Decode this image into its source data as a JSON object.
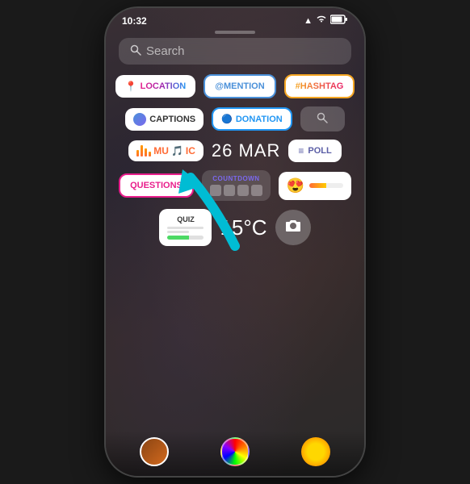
{
  "phone": {
    "status_bar": {
      "time": "10:32",
      "signal_icon": "▲",
      "wifi_icon": "wifi",
      "battery_icon": "battery"
    },
    "search": {
      "placeholder": "Search"
    },
    "rows": [
      {
        "id": "row1",
        "stickers": [
          {
            "id": "location",
            "label": "LOCATION",
            "type": "location"
          },
          {
            "id": "mention",
            "label": "@MENTION",
            "type": "mention"
          },
          {
            "id": "hashtag",
            "label": "#HASHTAG",
            "type": "hashtag"
          }
        ]
      },
      {
        "id": "row2",
        "stickers": [
          {
            "id": "captions",
            "label": "CAPTIONS",
            "type": "captions"
          },
          {
            "id": "donation",
            "label": "DONATION",
            "type": "donation"
          },
          {
            "id": "search_small",
            "label": "",
            "type": "search_small"
          }
        ]
      },
      {
        "id": "row3",
        "stickers": [
          {
            "id": "music",
            "label": "MU IC",
            "type": "music"
          },
          {
            "id": "date",
            "label": "26 MAR",
            "type": "date"
          },
          {
            "id": "poll",
            "label": "POLL",
            "type": "poll"
          }
        ]
      },
      {
        "id": "row4",
        "stickers": [
          {
            "id": "questions",
            "label": "QUESTIONS",
            "type": "questions"
          },
          {
            "id": "countdown",
            "label": "COUNTDOWN",
            "type": "countdown"
          },
          {
            "id": "emoji",
            "label": "😍",
            "type": "emoji"
          }
        ]
      },
      {
        "id": "row5",
        "stickers": [
          {
            "id": "quiz",
            "label": "QUIZ",
            "type": "quiz"
          },
          {
            "id": "temp",
            "label": "15°C",
            "type": "temp"
          },
          {
            "id": "camera",
            "label": "",
            "type": "camera"
          }
        ]
      }
    ]
  }
}
